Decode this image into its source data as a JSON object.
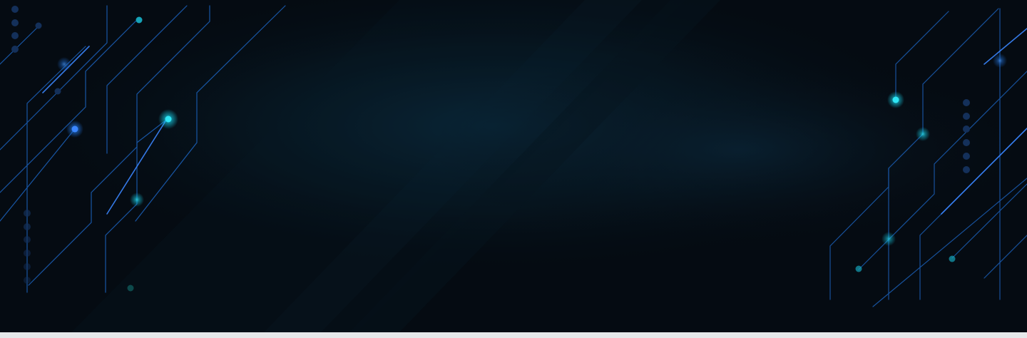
{
  "banner": {
    "style": "dark circuit-board hero background",
    "colors": {
      "background": "#050b12",
      "center_glow": "#0a2a3d",
      "trace_blue": "#1f6fd6",
      "trace_cyan": "#16c1d8",
      "node_dark": "#14305a",
      "bottom_strip": "#e6e8ea"
    },
    "decorations": [
      "left-circuit-traces",
      "right-circuit-traces",
      "diagonal-light-bands"
    ]
  }
}
